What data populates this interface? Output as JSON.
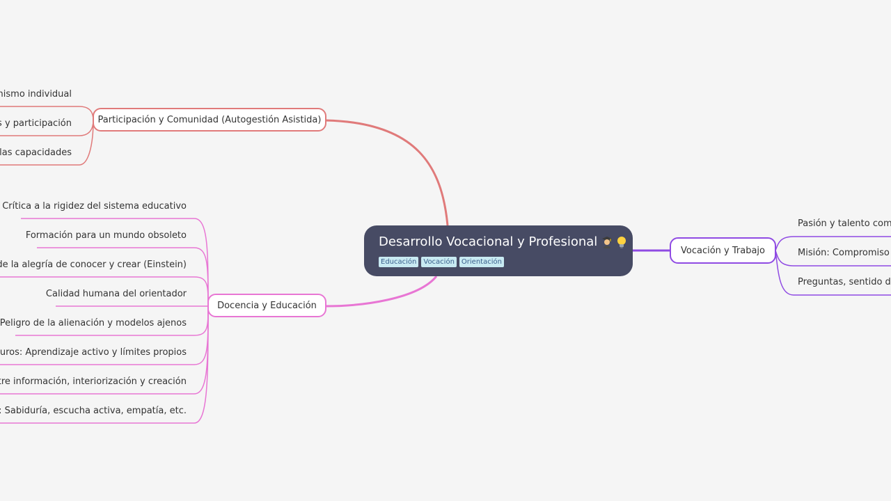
{
  "root": {
    "title": "Desarrollo Vocacional y Profesional",
    "tags": [
      "Educación",
      "Vocación",
      "Orientación"
    ],
    "icons": [
      "student-emoji-icon",
      "lightbulb-emoji-icon"
    ]
  },
  "colors": {
    "background": "#f5f5f5",
    "root_fill": "#474b64",
    "tag_fill": "#c8eaf2",
    "participacion": "#e07a7a",
    "docencia": "#e876d4",
    "vocacion": "#8f4ae3"
  },
  "branches": {
    "participacion": {
      "label": "Participación y Comunidad (Autogestión Asistida)",
      "leaves": [
        "onismo individual",
        "es y participación",
        "e las capacidades"
      ]
    },
    "docencia": {
      "label": "Docencia y Educación",
      "leaves": [
        "Crítica a la rigidez del sistema educativo",
        "Formación para un mundo obsoleto",
        "ncia de la alegría de conocer y crear (Einstein)",
        "Calidad humana del orientador",
        "Peligro de la alienación y modelos ajenos",
        "n muros: Aprendizaje activo y límites propios",
        " entre información, interiorización y creación",
        "ador: Sabiduría, escucha activa, empatía, etc."
      ]
    },
    "vocacion": {
      "label": "Vocación y Trabajo",
      "leaves": [
        "Pasión y talento como",
        "Misión: Compromiso so",
        "Preguntas, sentido de v"
      ]
    }
  }
}
